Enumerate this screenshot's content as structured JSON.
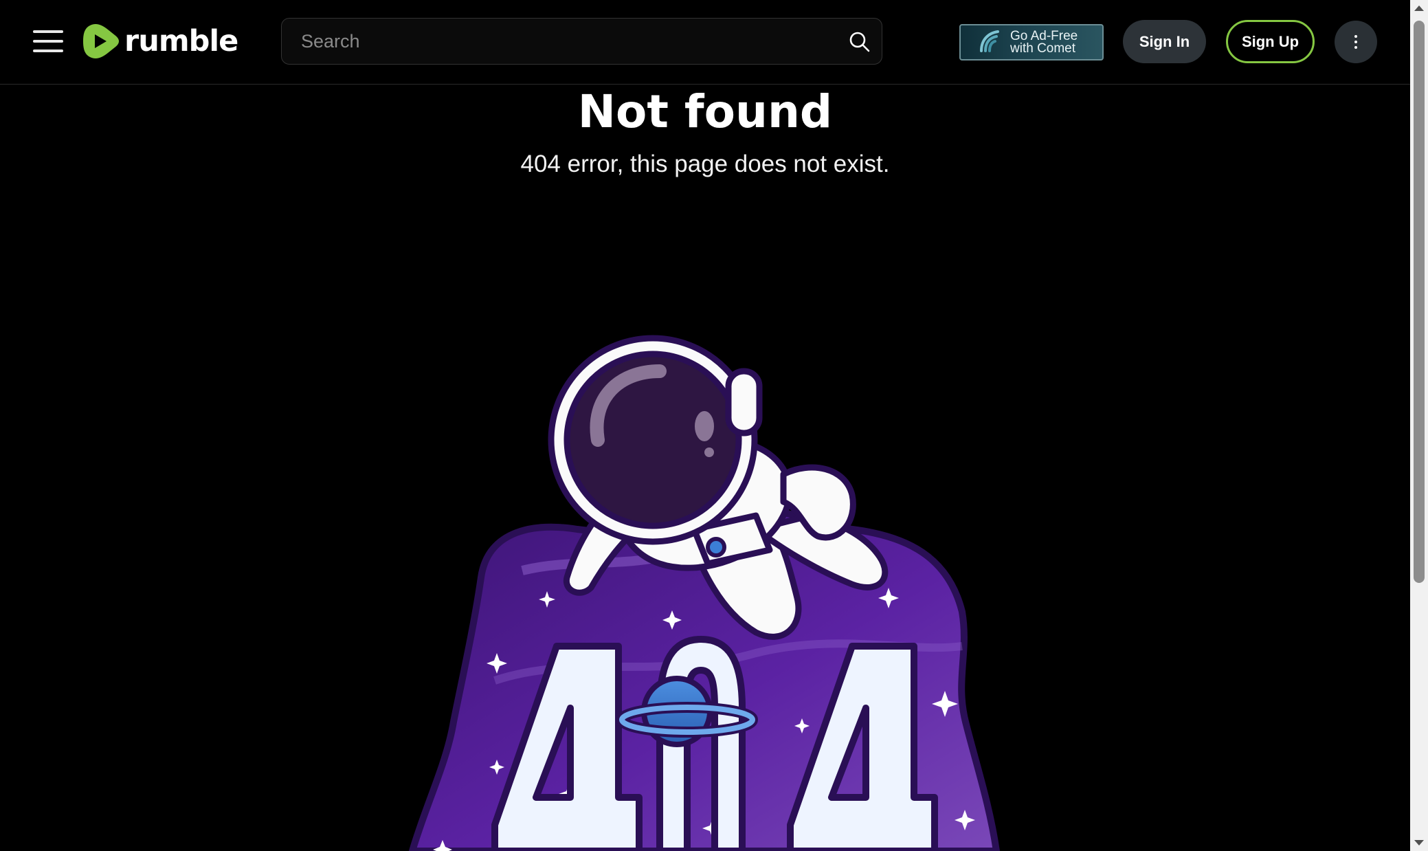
{
  "header": {
    "logo_text": "rumble",
    "search_placeholder": "Search",
    "comet_line1": "Go Ad-Free",
    "comet_line2": "with Comet",
    "sign_in": "Sign In",
    "sign_up": "Sign Up"
  },
  "main": {
    "title": "Not found",
    "subtitle": "404 error, this page does not exist.",
    "illustration_text": "404"
  },
  "colors": {
    "brand_green": "#85c742",
    "purple": "#5b22a3",
    "background": "#000000"
  },
  "icons": {
    "menu": "hamburger-menu-icon",
    "search": "search-icon",
    "more": "more-vertical-icon",
    "comet": "comet-icon"
  }
}
